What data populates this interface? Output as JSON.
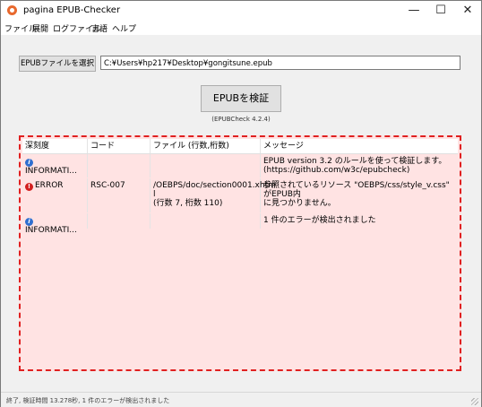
{
  "window": {
    "title": "pagina EPUB-Checker"
  },
  "menu": [
    "ファイル",
    "展開",
    "ログファイル",
    "言語",
    "ヘルプ"
  ],
  "toolbar": {
    "select_label": "EPUBファイルを選択",
    "path_value": "C:¥Users¥hp217¥Desktop¥gongitsune.epub"
  },
  "validate": {
    "label": "EPUBを検証",
    "version": "(EPUBCheck 4.2.4)"
  },
  "table": {
    "headers": [
      "深刻度",
      "コード",
      "ファイル (行数,桁数)",
      "メッセージ"
    ],
    "rows": [
      {
        "severity": "INFORMATI...",
        "severity_icon": "info-icon",
        "code": "",
        "file": "",
        "message_lines": [
          "EPUB version 3.2 のルールを使って検証します。",
          "(https://github.com/w3c/epubcheck)"
        ]
      },
      {
        "severity": "ERROR",
        "severity_icon": "error-icon",
        "code": "RSC-007",
        "file_lines": [
          "/OEBPS/doc/section0001.xhtm",
          "l",
          "(行数 7, 桁数 110)"
        ],
        "message_lines": [
          "参照されているリソース \"OEBPS/css/style_v.css\" がEPUB内",
          "に見つかりません。"
        ]
      },
      {
        "severity": "INFORMATI...",
        "severity_icon": "info-icon",
        "code": "",
        "file": "",
        "message_lines": [
          "1 件のエラーが検出されました"
        ]
      }
    ]
  },
  "status": {
    "text": "終了, 検証時間 13.278秒, 1 件のエラーが検出されました"
  },
  "colors": {
    "results_bg": "#ffe3e3",
    "highlight_border": "#e02020",
    "info": "#2f6fd0",
    "error": "#d21f1f"
  }
}
